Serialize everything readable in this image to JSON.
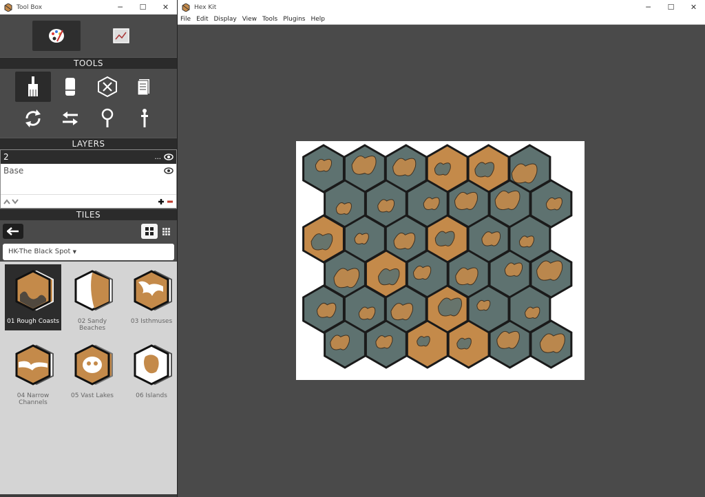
{
  "toolbox": {
    "title": "Tool Box",
    "sections": {
      "tools": "TOOLS",
      "layers": "LAYERS",
      "tiles": "TILES"
    },
    "layers": [
      {
        "name": "2",
        "selected": true
      },
      {
        "name": "Base",
        "selected": false
      }
    ],
    "ellipsis": "...",
    "tileset": "HK-The Black Spot",
    "tiles": [
      {
        "label": "01 Rough Coasts",
        "selected": true
      },
      {
        "label": "02 Sandy Beaches",
        "selected": false
      },
      {
        "label": "03 Isthmuses",
        "selected": false
      },
      {
        "label": "04 Narrow Channels",
        "selected": false
      },
      {
        "label": "05 Vast Lakes",
        "selected": false
      },
      {
        "label": "06 Islands",
        "selected": false
      }
    ]
  },
  "main": {
    "title": "Hex Kit",
    "menu": [
      "File",
      "Edit",
      "Display",
      "View",
      "Tools",
      "Plugins",
      "Help"
    ]
  },
  "colors": {
    "land": "#c48a4a",
    "water": "#5e7270",
    "ink": "#1a1a1a"
  }
}
